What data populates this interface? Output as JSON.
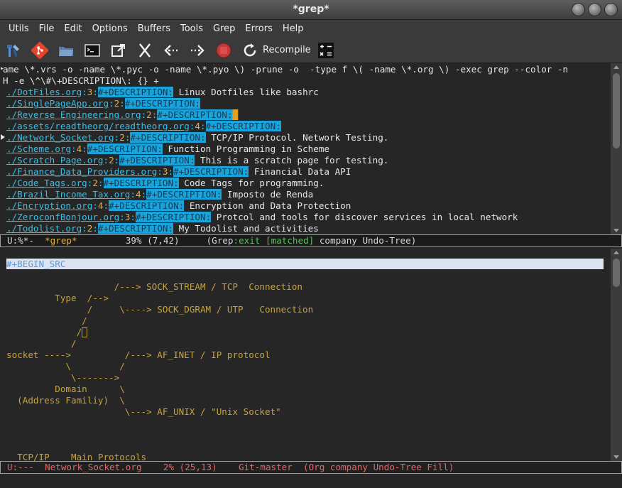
{
  "window": {
    "title": "*grep*"
  },
  "menu": {
    "items": [
      "Utils",
      "File",
      "Edit",
      "Options",
      "Buffers",
      "Tools",
      "Grep",
      "Errors",
      "Help"
    ]
  },
  "toolbar": {
    "icons": [
      "wrench-hammer-icon",
      "git-icon",
      "folder-icon",
      "terminal-icon",
      "external-window-icon",
      "cut-icon",
      "back-arrow-icon",
      "forward-arrow-icon",
      "stop-icon",
      "recompile-icon",
      "calculator-icon"
    ],
    "recompile_label": "Recompile"
  },
  "grep": {
    "cmd1": "ame \\*.vrs -o -name \\*.pyc -o -name \\*.pyo \\) -prune -o  -type f \\( -name \\*.org \\) -exec grep --color -n",
    "cmd2": "H -e \\^\\#\\+DESCRIPTION\\: {} +",
    "results": [
      {
        "file": "./DotFiles.org",
        "line": "3",
        "tag": "#+DESCRIPTION:",
        "text": " Linux Dotfiles like bashrc"
      },
      {
        "file": "./SinglePageApp.org",
        "line": "2",
        "tag": "#+DESCRIPTION:",
        "text": ""
      },
      {
        "file": "./Reverse Engineering.org",
        "line": "2",
        "tag": "#+DESCRIPTION:",
        "text": ""
      },
      {
        "file": "./assets/readtheorg/readtheorg.org",
        "line": "4",
        "tag": "#+DESCRIPTION:",
        "text": ""
      },
      {
        "file": "./Network_Socket.org",
        "line": "2",
        "tag": "#+DESCRIPTION:",
        "text": " TCP/IP Protocol. Network Testing."
      },
      {
        "file": "./Scheme.org",
        "line": "4",
        "tag": "#+DESCRIPTION:",
        "text": " Function Programming in Scheme"
      },
      {
        "file": "./Scratch Page.org",
        "line": "2",
        "tag": "#+DESCRIPTION:",
        "text": " This is a scratch page for testing."
      },
      {
        "file": "./Finance_Data_Providers.org",
        "line": "3",
        "tag": "#+DESCRIPTION:",
        "text": " Financial Data API"
      },
      {
        "file": "./Code_Tags.org",
        "line": "2",
        "tag": "#+DESCRIPTION:",
        "text": " Code Tags for programming."
      },
      {
        "file": "./Brazil_Income_Tax.org",
        "line": "4",
        "tag": "#+DESCRIPTION:",
        "text": " Imposto de Renda"
      },
      {
        "file": "./Encryption.org",
        "line": "4",
        "tag": "#+DESCRIPTION:",
        "text": " Encryption and Data Protection"
      },
      {
        "file": "./ZeroconfBonjour.org",
        "line": "3",
        "tag": "#+DESCRIPTION:",
        "text": " Protcol and tools for discover services in local network"
      },
      {
        "file": "./Todolist.org",
        "line": "2",
        "tag": "#+DESCRIPTION:",
        "text": " My Todolist and activities"
      }
    ]
  },
  "modeline1": {
    "state": "U:%*-  ",
    "buffer": "*grep*",
    "position": "         39% (7,42)     ",
    "mode_open": "(Grep",
    "exit": ":exit",
    "matched": " [matched]",
    "rest": " company Undo-Tree)"
  },
  "source": {
    "begin_src": "#+BEGIN_SRC",
    "lines": [
      "                    /---> SOCK_STREAM / TCP  Connection",
      "         Type  /-->",
      "               /     \\----> SOCK_DGRAM / UTP   Connection",
      "              /",
      "             /",
      "            /",
      "socket ---->          /---> AF_INET / IP protocol",
      "           \\         /",
      "            \\------->",
      "         Domain      \\",
      "  (Address Familiy)  \\",
      "                      \\---> AF_UNIX / \"Unix Socket\"",
      "",
      "",
      "",
      "  TCP/IP    Main Protocols"
    ]
  },
  "modeline2": {
    "text": "U:---  Network_Socket.org    2% (25,13)    Git-master  (Org company Undo-Tree Fill)"
  }
}
